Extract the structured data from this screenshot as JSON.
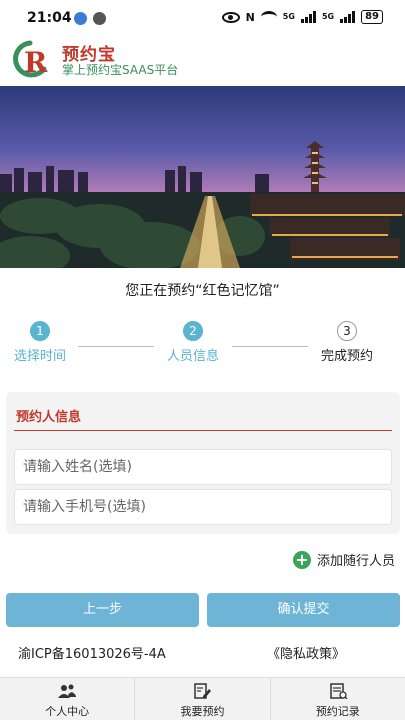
{
  "status_bar": {
    "time": "21:04",
    "battery": "89"
  },
  "header": {
    "brand": "预约宝",
    "tagline": "掌上预约宝SAAS平台",
    "logo_letter": "R"
  },
  "banner": {
    "image": "night cityscape with pagoda and lit boulevard"
  },
  "venue_line": "您正在预约“红色记忆馆”",
  "steps": [
    {
      "num": "1",
      "label": "选择时间",
      "state": "active"
    },
    {
      "num": "2",
      "label": "人员信息",
      "state": "active"
    },
    {
      "num": "3",
      "label": "完成预约",
      "state": "pending"
    }
  ],
  "form": {
    "title": "预约人信息",
    "name_placeholder": "请输入姓名(选填)",
    "phone_placeholder": "请输入手机号(选填)"
  },
  "add_companion": "添加随行人员",
  "buttons": {
    "prev": "上一步",
    "submit": "确认提交"
  },
  "footer": {
    "icp": "渝ICP备16013026号-4A",
    "privacy": "《隐私政策》"
  },
  "bottom_nav": [
    {
      "label": "个人中心",
      "icon": "users-icon"
    },
    {
      "label": "我要预约",
      "icon": "edit-form-icon"
    },
    {
      "label": "预约记录",
      "icon": "record-list-icon"
    }
  ],
  "colors": {
    "accent": "#58b4cf",
    "button": "#6db4d6",
    "brand_red": "#c0392b",
    "brand_green": "#3a8f5c"
  }
}
